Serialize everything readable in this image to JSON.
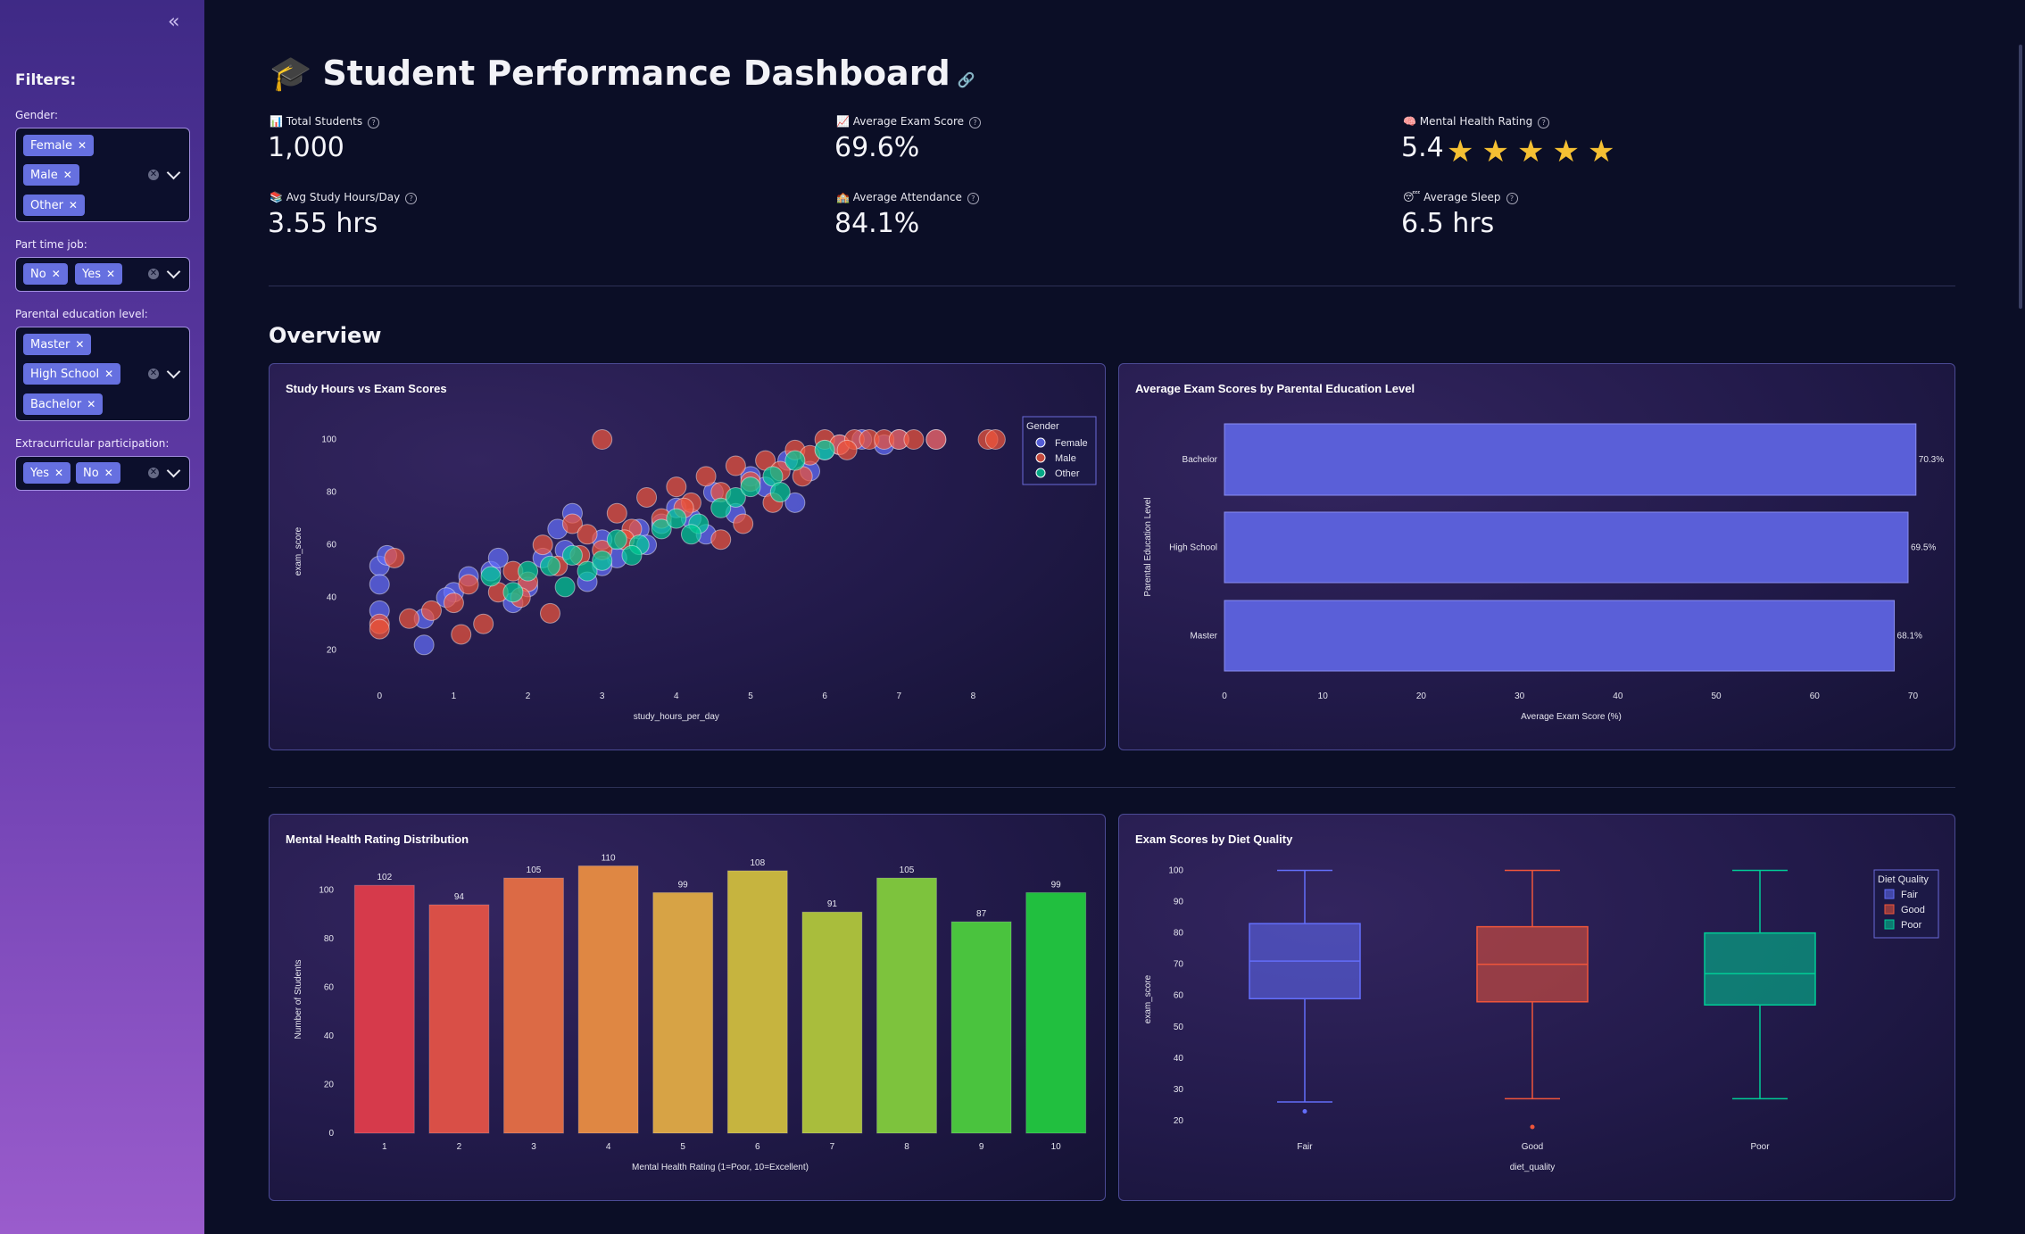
{
  "sidebar": {
    "collapse_icon": "double-chevron-left-icon",
    "filters_title": "Filters:",
    "groups": [
      {
        "label": "Gender:",
        "tags": [
          "Female",
          "Male",
          "Other"
        ]
      },
      {
        "label": "Part time job:",
        "tags": [
          "No",
          "Yes"
        ]
      },
      {
        "label": "Parental education level:",
        "tags": [
          "Master",
          "High School",
          "Bachelor"
        ]
      },
      {
        "label": "Extracurricular participation:",
        "tags": [
          "Yes",
          "No"
        ]
      }
    ]
  },
  "header": {
    "icon": "🎓",
    "title": "Student Performance Dashboard",
    "link_icon": "link-icon"
  },
  "metrics": [
    {
      "emoji": "📊",
      "label": "Total Students",
      "value": "1,000"
    },
    {
      "emoji": "📈",
      "label": "Average Exam Score",
      "value": "69.6%"
    },
    {
      "emoji": "🧠",
      "label": "Mental Health Rating",
      "value": "5.4"
    },
    {
      "emoji": "📚",
      "label": "Avg Study Hours/Day",
      "value": "3.55 hrs"
    },
    {
      "emoji": "🏫",
      "label": "Average Attendance",
      "value": "84.1%"
    },
    {
      "emoji": "😴",
      "label": "Average Sleep",
      "value": "6.5 hrs"
    }
  ],
  "mental_health_stars": {
    "rating": 5,
    "max": 5,
    "glyph": "★"
  },
  "overview_title": "Overview",
  "colors": {
    "female": "#636efa",
    "male": "#ef553b",
    "other": "#00cc96",
    "bar_blue": "#5a5fd8",
    "star": "#f5c033"
  },
  "chart_data": [
    {
      "type": "scatter",
      "title": "Study Hours vs Exam Scores",
      "xlabel": "study_hours_per_day",
      "ylabel": "exam_score",
      "xticks": [
        0,
        1,
        2,
        3,
        4,
        5,
        6,
        7,
        8
      ],
      "yticks": [
        20,
        40,
        60,
        80,
        100
      ],
      "xlim": [
        -0.4,
        8.5
      ],
      "ylim": [
        5,
        110
      ],
      "legend": {
        "title": "Gender",
        "position": "top-right",
        "entries": [
          "Female",
          "Male",
          "Other"
        ]
      },
      "series": [
        {
          "name": "Female",
          "x": [
            0,
            0,
            0,
            0.1,
            0.6,
            1.0,
            1.5,
            2.0,
            2.5,
            3.0,
            3.2,
            3.5,
            4.0,
            4.5,
            5.0,
            5.5,
            6.0,
            6.5,
            7.0,
            7.5,
            0.6,
            1.2,
            1.8,
            2.2,
            2.8,
            3.6,
            4.2,
            4.8,
            5.2,
            5.8,
            6.2,
            6.8,
            3.0,
            2.4,
            1.6,
            0.9,
            4.4,
            5.6,
            3.8,
            2.6
          ],
          "y": [
            52,
            45,
            35,
            56,
            32,
            42,
            50,
            44,
            58,
            62,
            55,
            66,
            74,
            80,
            86,
            92,
            96,
            100,
            100,
            100,
            22,
            48,
            38,
            55,
            46,
            60,
            70,
            72,
            82,
            88,
            98,
            98,
            52,
            66,
            55,
            40,
            64,
            76,
            68,
            72
          ]
        },
        {
          "name": "Male",
          "x": [
            0,
            0,
            0.2,
            0.4,
            0.7,
            1.0,
            1.2,
            1.4,
            1.6,
            1.8,
            2.0,
            2.2,
            2.4,
            2.6,
            2.8,
            3.0,
            3.2,
            3.4,
            3.6,
            3.8,
            4.0,
            4.2,
            4.4,
            4.6,
            4.8,
            5.0,
            5.2,
            5.4,
            5.6,
            5.8,
            6.0,
            6.2,
            6.4,
            6.6,
            6.8,
            7.0,
            7.2,
            7.5,
            8.2,
            8.3,
            1.1,
            1.9,
            2.7,
            3.3,
            4.1,
            4.9,
            5.7,
            6.3,
            3.0,
            2.3,
            4.6,
            5.3
          ],
          "y": [
            30,
            28,
            55,
            32,
            35,
            38,
            45,
            30,
            42,
            50,
            46,
            60,
            52,
            68,
            64,
            58,
            72,
            66,
            78,
            70,
            82,
            76,
            86,
            80,
            90,
            84,
            92,
            88,
            96,
            94,
            100,
            98,
            100,
            100,
            100,
            100,
            100,
            100,
            100,
            100,
            26,
            40,
            56,
            62,
            74,
            68,
            86,
            96,
            100,
            34,
            62,
            76
          ]
        },
        {
          "name": "Other",
          "x": [
            1.5,
            1.8,
            2.0,
            2.3,
            2.6,
            2.8,
            3.0,
            3.2,
            3.5,
            3.8,
            4.0,
            4.3,
            4.6,
            4.8,
            5.0,
            5.3,
            5.6,
            6.0,
            2.5,
            3.4,
            4.2,
            5.4
          ],
          "y": [
            48,
            42,
            50,
            52,
            56,
            50,
            54,
            62,
            60,
            66,
            70,
            68,
            74,
            78,
            82,
            86,
            92,
            96,
            44,
            56,
            64,
            80
          ]
        }
      ]
    },
    {
      "type": "bar",
      "orientation": "horizontal",
      "title": "Average Exam Scores by Parental Education Level",
      "xlabel": "Average Exam Score (%)",
      "ylabel": "Parental Education Level",
      "categories": [
        "Bachelor",
        "High School",
        "Master"
      ],
      "values": [
        70.3,
        69.5,
        68.1
      ],
      "value_labels": [
        "70.3%",
        "69.5%",
        "68.1%"
      ],
      "xticks": [
        0,
        10,
        20,
        30,
        40,
        50,
        60,
        70
      ],
      "xlim": [
        0,
        70.5
      ]
    },
    {
      "type": "bar",
      "title": "Mental Health Rating Distribution",
      "xlabel": "Mental Health Rating (1=Poor, 10=Excellent)",
      "ylabel": "Number of Students",
      "categories": [
        "1",
        "2",
        "3",
        "4",
        "5",
        "6",
        "7",
        "8",
        "9",
        "10"
      ],
      "values": [
        102,
        94,
        105,
        110,
        99,
        108,
        91,
        105,
        87,
        99
      ],
      "colors": [
        "#d63a4b",
        "#d94f47",
        "#dc6a45",
        "#df8743",
        "#d7a345",
        "#c6b43f",
        "#a9bd3c",
        "#7dc33d",
        "#4ac33e",
        "#21bf3f"
      ],
      "yticks": [
        0,
        20,
        40,
        60,
        80,
        100
      ],
      "ylim": [
        0,
        112
      ]
    },
    {
      "type": "box",
      "title": "Exam Scores by Diet Quality",
      "xlabel": "diet_quality",
      "ylabel": "exam_score",
      "categories": [
        "Fair",
        "Good",
        "Poor"
      ],
      "yticks": [
        20,
        30,
        40,
        50,
        60,
        70,
        80,
        90,
        100
      ],
      "ylim": [
        16,
        103
      ],
      "legend": {
        "title": "Diet Quality",
        "position": "top-right",
        "entries": [
          "Fair",
          "Good",
          "Poor"
        ]
      },
      "boxes": [
        {
          "name": "Fair",
          "min": 26,
          "q1": 59,
          "median": 71,
          "q3": 83,
          "max": 100,
          "outliers": [
            23
          ],
          "color": "#636efa"
        },
        {
          "name": "Good",
          "min": 27,
          "q1": 58,
          "median": 70,
          "q3": 82,
          "max": 100,
          "outliers": [
            18
          ],
          "color": "#ef553b"
        },
        {
          "name": "Poor",
          "min": 27,
          "q1": 57,
          "median": 67,
          "q3": 80,
          "max": 100,
          "outliers": [],
          "color": "#00cc96"
        }
      ]
    }
  ]
}
